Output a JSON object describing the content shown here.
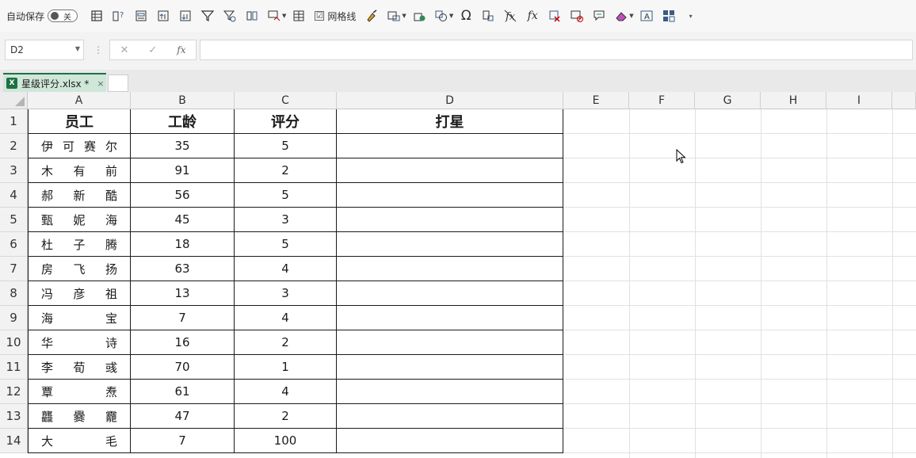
{
  "toolbar": {
    "autosave_label": "自动保存",
    "autosave_state": "关",
    "gridlines_label": "网格线",
    "gridlines_checked": "☑",
    "icons": [
      "freeze-icon",
      "help-icon",
      "form-icon",
      "sort-asc-icon",
      "sort-desc-icon",
      "filter-icon",
      "advanced-filter-icon",
      "text-to-col-icon",
      "validation-icon",
      "table-icon",
      "brush-icon",
      "merge-icon",
      "insert-chart-icon",
      "shape-icon",
      "omega-icon",
      "paste-special-icon",
      "clear-format-icon",
      "fx-icon",
      "delete-cell-icon",
      "remove-dup-icon",
      "comment-icon",
      "eraser-icon",
      "textbox-icon",
      "grid-icon",
      "more-icon"
    ]
  },
  "formula_bar": {
    "name_box": "D2",
    "cancel": "✕",
    "confirm": "✓",
    "fx": "fx",
    "sep": "⋮",
    "value": ""
  },
  "tabs": {
    "file_badge": "X",
    "file_name": "星级评分.xlsx *",
    "close": "×"
  },
  "sheet": {
    "columns": [
      "A",
      "B",
      "C",
      "D",
      "E",
      "F",
      "G",
      "H",
      "I"
    ],
    "rows": [
      "1",
      "2",
      "3",
      "4",
      "5",
      "6",
      "7",
      "8",
      "9",
      "10",
      "11",
      "12",
      "13",
      "14"
    ],
    "headers": [
      "员工",
      "工龄",
      "评分",
      "打星"
    ],
    "data": [
      {
        "name": [
          "伊",
          "可",
          "赛",
          "尔"
        ],
        "age": "35",
        "score": "5"
      },
      {
        "name": [
          "木",
          "有",
          "前"
        ],
        "age": "91",
        "score": "2"
      },
      {
        "name": [
          "郝",
          "新",
          "酷"
        ],
        "age": "56",
        "score": "5"
      },
      {
        "name": [
          "甄",
          "妮",
          "海"
        ],
        "age": "45",
        "score": "3"
      },
      {
        "name": [
          "杜",
          "子",
          "腾"
        ],
        "age": "18",
        "score": "5"
      },
      {
        "name": [
          "房",
          "飞",
          "扬"
        ],
        "age": "63",
        "score": "4"
      },
      {
        "name": [
          "冯",
          "彦",
          "祖"
        ],
        "age": "13",
        "score": "3"
      },
      {
        "name": [
          "海",
          "宝"
        ],
        "age": "7",
        "score": "4"
      },
      {
        "name": [
          "华",
          "诗"
        ],
        "age": "16",
        "score": "2"
      },
      {
        "name": [
          "李",
          "荀",
          "彧"
        ],
        "age": "70",
        "score": "1"
      },
      {
        "name": [
          "覃",
          "焘"
        ],
        "age": "61",
        "score": "4"
      },
      {
        "name": [
          "龘",
          "爨",
          "龗"
        ],
        "age": "47",
        "score": "2"
      },
      {
        "name": [
          "大",
          "毛"
        ],
        "age": "7",
        "score": "100"
      }
    ]
  },
  "colors": {
    "accent": "#1e7145",
    "tab_bg": "#cfe7d9",
    "icon": "#3a5b85"
  }
}
